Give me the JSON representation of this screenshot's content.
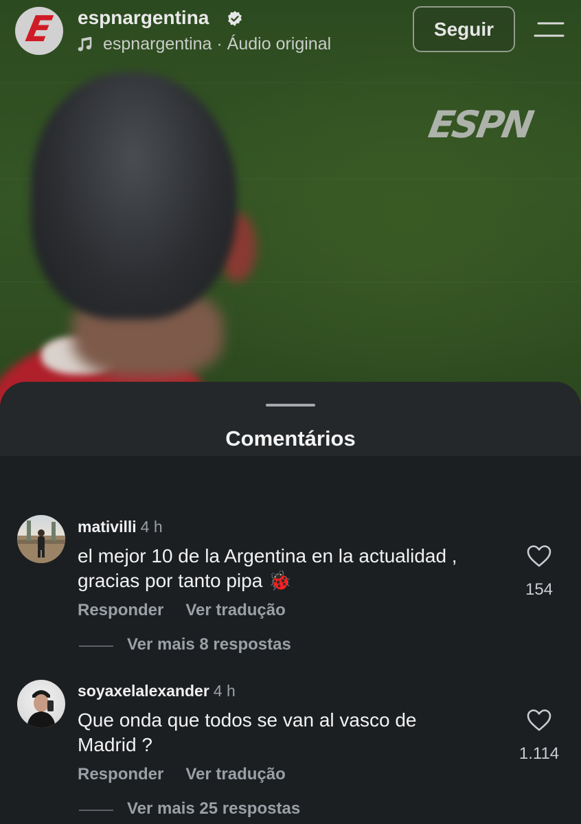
{
  "header": {
    "account_name": "espnargentina",
    "audio_line": "espnargentina · Áudio original",
    "follow_label": "Seguir",
    "avatar_letter": "E"
  },
  "video": {
    "watermark": "ESPN"
  },
  "sheet": {
    "title": "Comentários"
  },
  "comments": [
    {
      "user": "mativilli",
      "time": "4 h",
      "line1": "el mejor 10 de la Argentina en la actualidad ,",
      "line2": "gracias por tanto pipa 🐞",
      "reply_label": "Responder",
      "translate_label": "Ver tradução",
      "more_replies": "Ver mais 8 respostas",
      "likes": "154"
    },
    {
      "user": "soyaxelalexander",
      "time": "4 h",
      "line1": "Que onda que todos se van al vasco de",
      "line2": "Madrid ?",
      "reply_label": "Responder",
      "translate_label": "Ver tradução",
      "more_replies": "Ver mais 25 respostas",
      "likes": "1.114"
    }
  ],
  "colors": {
    "espn_red": "#cf1b25",
    "sheet_bg": "#1c1f22",
    "muted_text": "#9aa0a6"
  },
  "icons": [
    "verified-badge-icon",
    "music-note-icon",
    "menu-icon",
    "heart-icon"
  ]
}
